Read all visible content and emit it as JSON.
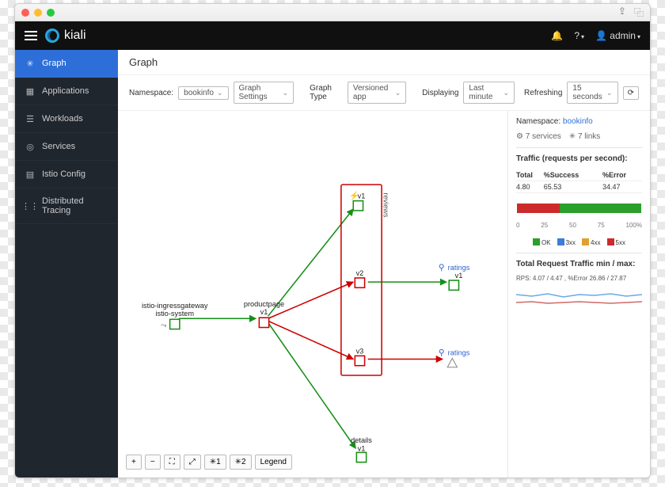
{
  "brand": "kiali",
  "user": "admin",
  "sidebar": {
    "items": [
      {
        "label": "Graph",
        "icon": "graph"
      },
      {
        "label": "Applications",
        "icon": "apps"
      },
      {
        "label": "Workloads",
        "icon": "workloads"
      },
      {
        "label": "Services",
        "icon": "services"
      },
      {
        "label": "Istio Config",
        "icon": "config"
      },
      {
        "label": "Distributed Tracing",
        "icon": "tracing"
      }
    ],
    "activeIndex": 0
  },
  "page": {
    "title": "Graph"
  },
  "toolbar": {
    "namespace_label": "Namespace:",
    "namespace_value": "bookinfo",
    "graph_settings_label": "Graph Settings",
    "graph_type_label": "Graph Type",
    "graph_type_value": "Versioned app",
    "displaying_label": "Displaying",
    "displaying_value": "Last minute",
    "refreshing_label": "Refreshing",
    "refreshing_value": "15 seconds"
  },
  "graph": {
    "nodes": {
      "ingress": {
        "line1": "istio-ingressgateway",
        "line2": "istio-system"
      },
      "productpage": {
        "label": "productpage",
        "version": "v1"
      },
      "reviews_group": "reviews",
      "reviews_v1": "v1",
      "reviews_v2": "v2",
      "reviews_v3": "v3",
      "details": {
        "label": "details",
        "version": "v1"
      },
      "ratings1": "ratings",
      "ratings1_v": "v1",
      "ratings2": "ratings"
    },
    "controls": {
      "zoom_in": "+",
      "zoom_out": "−",
      "fit": "⛶",
      "layout0": "⤢",
      "layout1": "✳1",
      "layout2": "✳2",
      "legend": "Legend"
    }
  },
  "panel": {
    "ns_label": "Namespace:",
    "ns_value": "bookinfo",
    "services_count": "7 services",
    "links_count": "7 links",
    "traffic_title": "Traffic (requests per second):",
    "table": {
      "h1": "Total",
      "h2": "%Success",
      "h3": "%Error",
      "total": "4.80",
      "success": "65.53",
      "error": "34.47"
    },
    "ticks": [
      "0",
      "25",
      "50",
      "75",
      "100"
    ],
    "tick_suffix": "%",
    "legend": {
      "ok": "OK",
      "c3": "3xx",
      "c4": "4xx",
      "c5": "5xx"
    },
    "colors": {
      "ok": "#2a9f2a",
      "c3": "#3b7dd8",
      "c4": "#e0a030",
      "c5": "#cc2b2b"
    },
    "spark_title": "Total Request Traffic min / max:",
    "spark_sub": "RPS: 4.07 / 4.47 , %Error 26.86 / 27.87"
  },
  "chart_data": {
    "type": "bar",
    "orientation": "horizontal-stacked",
    "categories": [
      "Traffic"
    ],
    "series": [
      {
        "name": "5xx",
        "values": [
          34.47
        ],
        "color": "#cc2b2b"
      },
      {
        "name": "OK",
        "values": [
          65.53
        ],
        "color": "#2a9f2a"
      }
    ],
    "xlim": [
      0,
      100
    ],
    "xlabel": "%",
    "title": "Traffic (requests per second)"
  }
}
